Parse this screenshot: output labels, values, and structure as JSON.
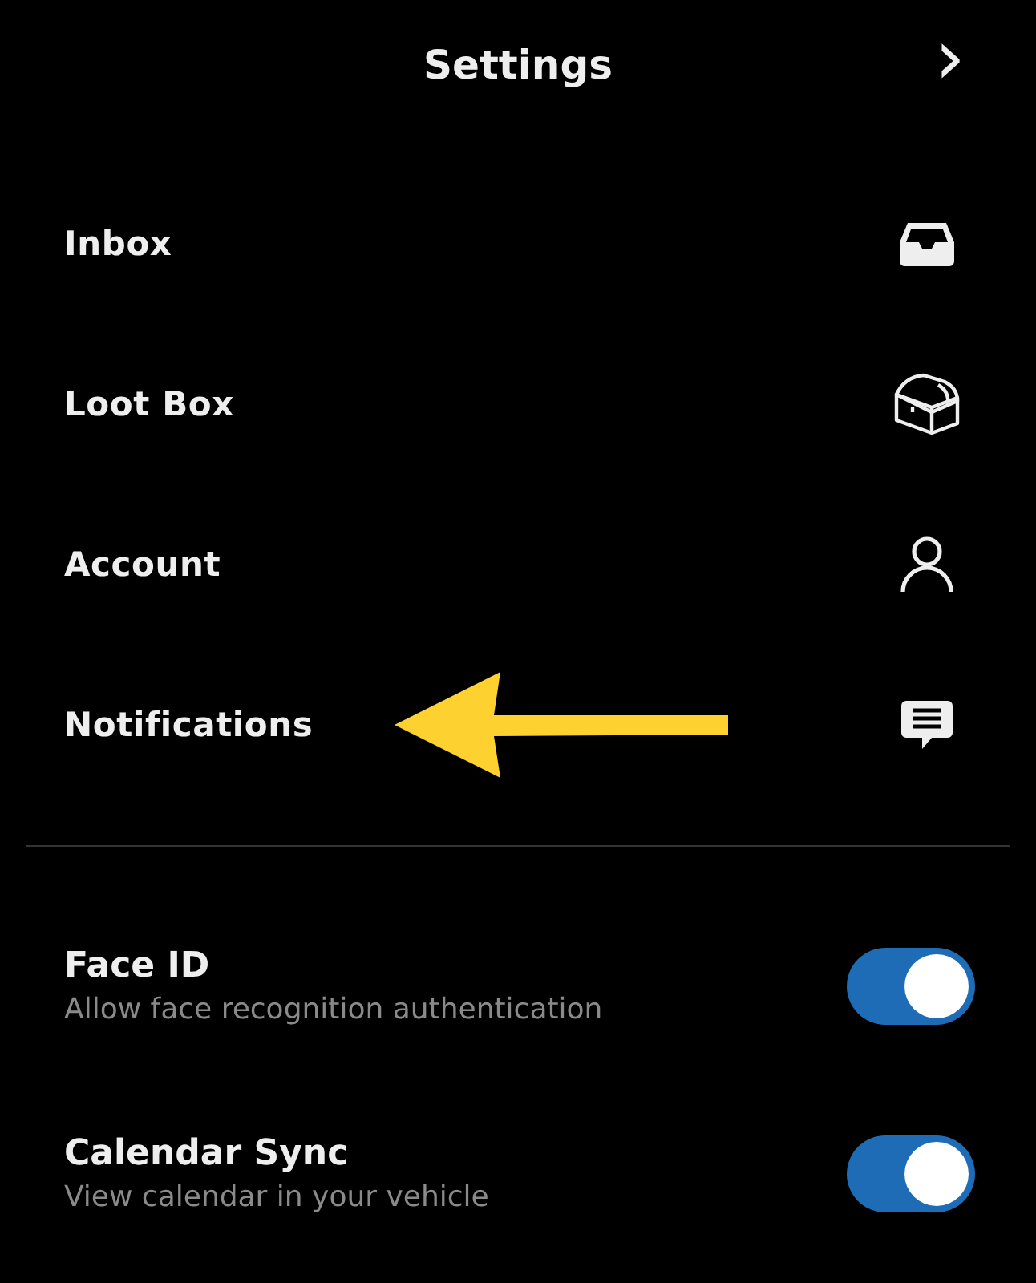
{
  "header": {
    "title": "Settings",
    "forward_icon": "›"
  },
  "menu": [
    {
      "label": "Inbox",
      "kind": "inbox",
      "highlighted": false
    },
    {
      "label": "Loot Box",
      "kind": "chest",
      "highlighted": false
    },
    {
      "label": "Account",
      "kind": "person",
      "highlighted": false
    },
    {
      "label": "Notifications",
      "kind": "message",
      "highlighted": true
    }
  ],
  "toggles": [
    {
      "label": "Face ID",
      "description": "Allow face recognition authentication",
      "on": true
    },
    {
      "label": "Calendar Sync",
      "description": "View calendar in your vehicle",
      "on": true
    }
  ]
}
